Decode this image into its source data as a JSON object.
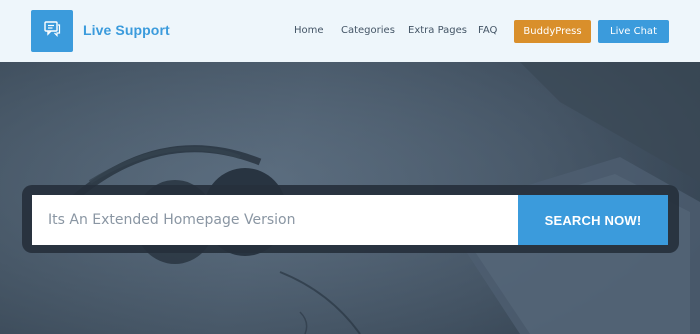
{
  "header": {
    "brand_name": "Live Support",
    "logo_icon": "chat-bubble-icon",
    "nav": [
      {
        "label": "Home"
      },
      {
        "label": "Categories"
      },
      {
        "label": "Extra Pages"
      },
      {
        "label": "FAQ"
      }
    ],
    "buddypress_label": "BuddyPress",
    "live_chat_label": "Live Chat"
  },
  "search": {
    "placeholder": "Its An Extended Homepage Version",
    "button_label": "SEARCH NOW!"
  },
  "colors": {
    "accent": "#3b9bdc",
    "buddypress": "#d98f2b",
    "header_bg": "#eef6fb"
  }
}
